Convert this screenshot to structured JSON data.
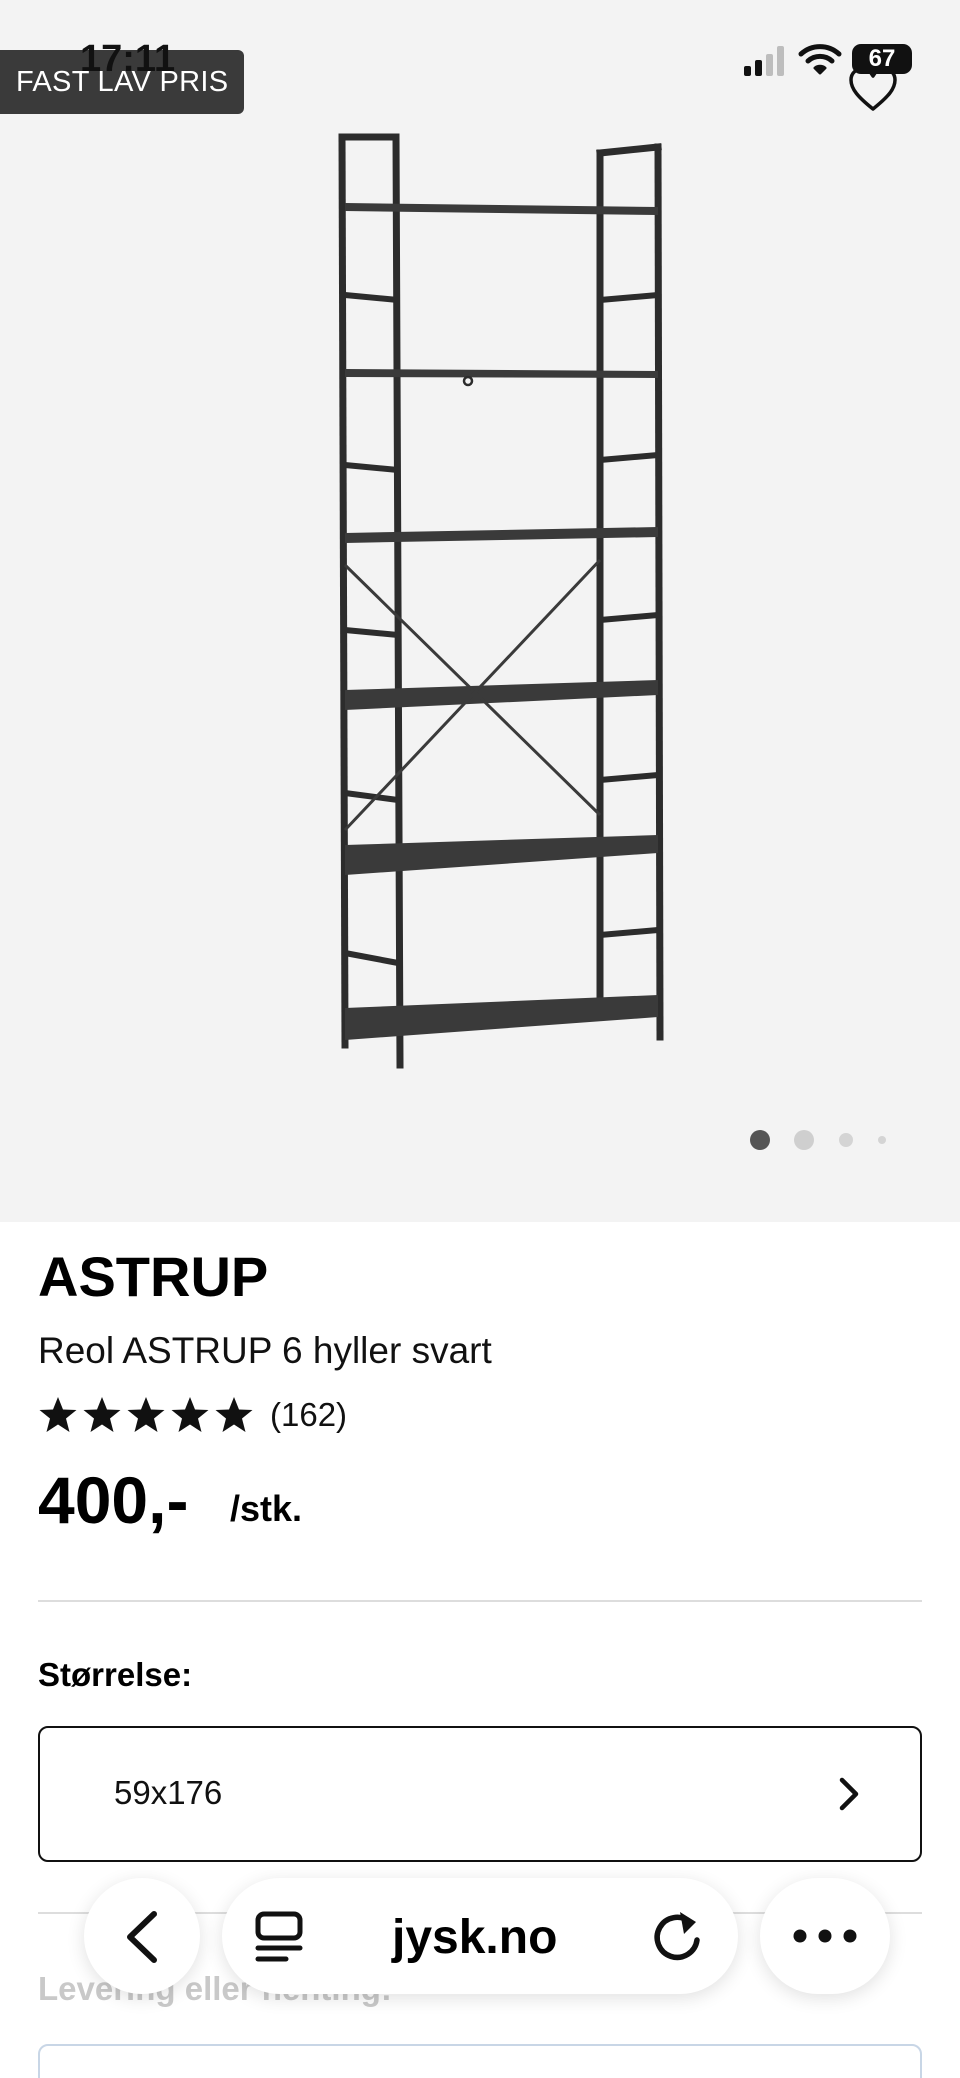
{
  "status_bar": {
    "time": "17:11",
    "battery": "67"
  },
  "product_image": {
    "badge": "FAST LAV PRIS",
    "favorite_icon": "heart-outline-icon",
    "carousel": {
      "count": 4,
      "active_index": 0
    }
  },
  "product": {
    "brand": "ASTRUP",
    "name": "Reol ASTRUP 6 hyller svart",
    "rating": {
      "stars": 5,
      "count": "(162)"
    },
    "price": "400,-",
    "unit": "/stk."
  },
  "size": {
    "label": "Størrelse:",
    "value": "59x176"
  },
  "delivery": {
    "label": "Levering eller henting:"
  },
  "browser": {
    "url": "jysk.no",
    "icons": [
      "back-icon",
      "reader-icon",
      "reload-icon",
      "more-icon"
    ]
  },
  "colors": {
    "image_bg": "#f3f3f3",
    "badge_bg": "#3a3a3a",
    "text": "#111111",
    "divider": "#dddddd"
  }
}
